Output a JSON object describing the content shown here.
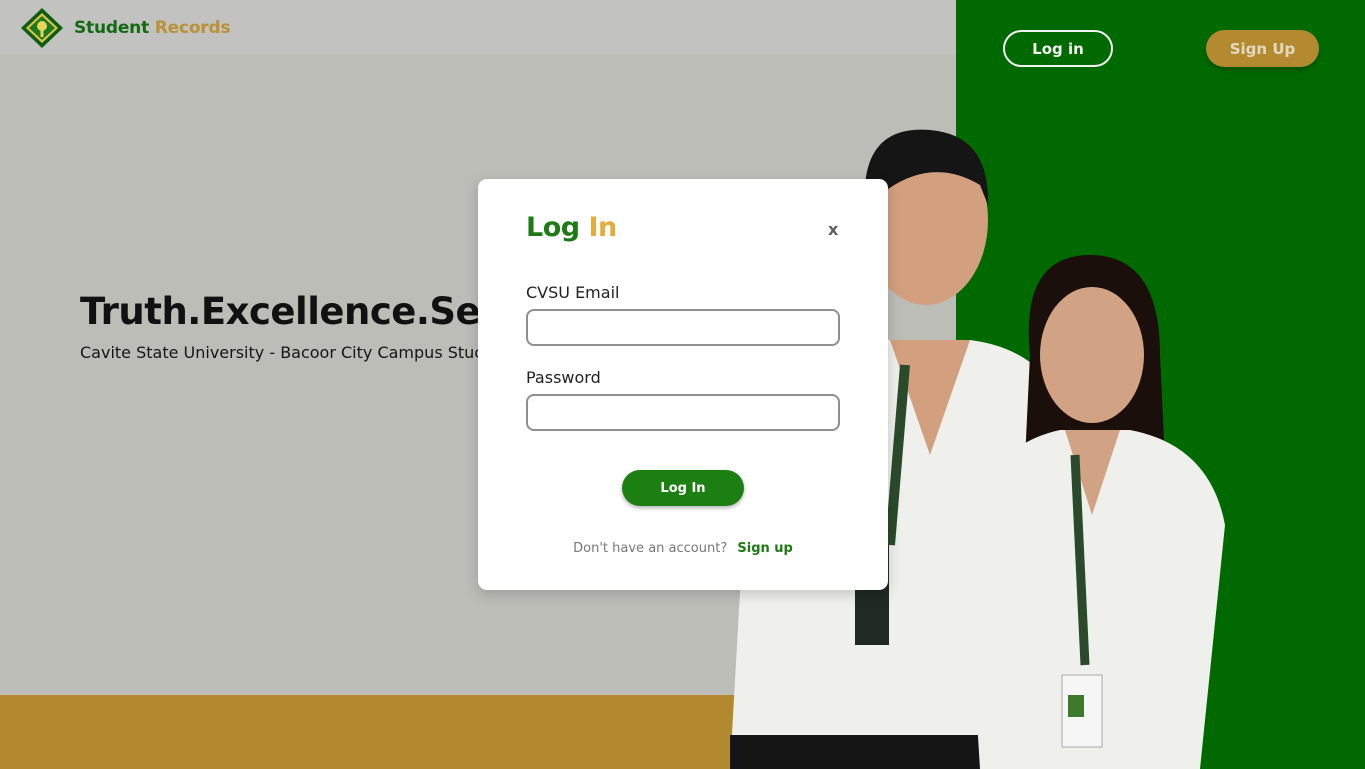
{
  "header": {
    "brand_primary": "Student",
    "brand_secondary": "Records",
    "login_label": "Log in",
    "signup_label": "Sign Up"
  },
  "hero": {
    "title": "Truth.Excellence.Serv",
    "subtitle": "Cavite State University - Bacoor City Campus Stuc"
  },
  "modal": {
    "title_primary": "Log",
    "title_secondary": "In",
    "close_label": "x",
    "email_label": "CVSU Email",
    "email_value": "",
    "password_label": "Password",
    "password_value": "",
    "submit_label": "Log In",
    "footer_question": "Don't have an account?",
    "footer_link": "Sign up"
  },
  "colors": {
    "brand_green": "#1e7a14",
    "brand_gold": "#b99136",
    "right_panel": "#006a00",
    "gold_band": "#b2892e"
  }
}
